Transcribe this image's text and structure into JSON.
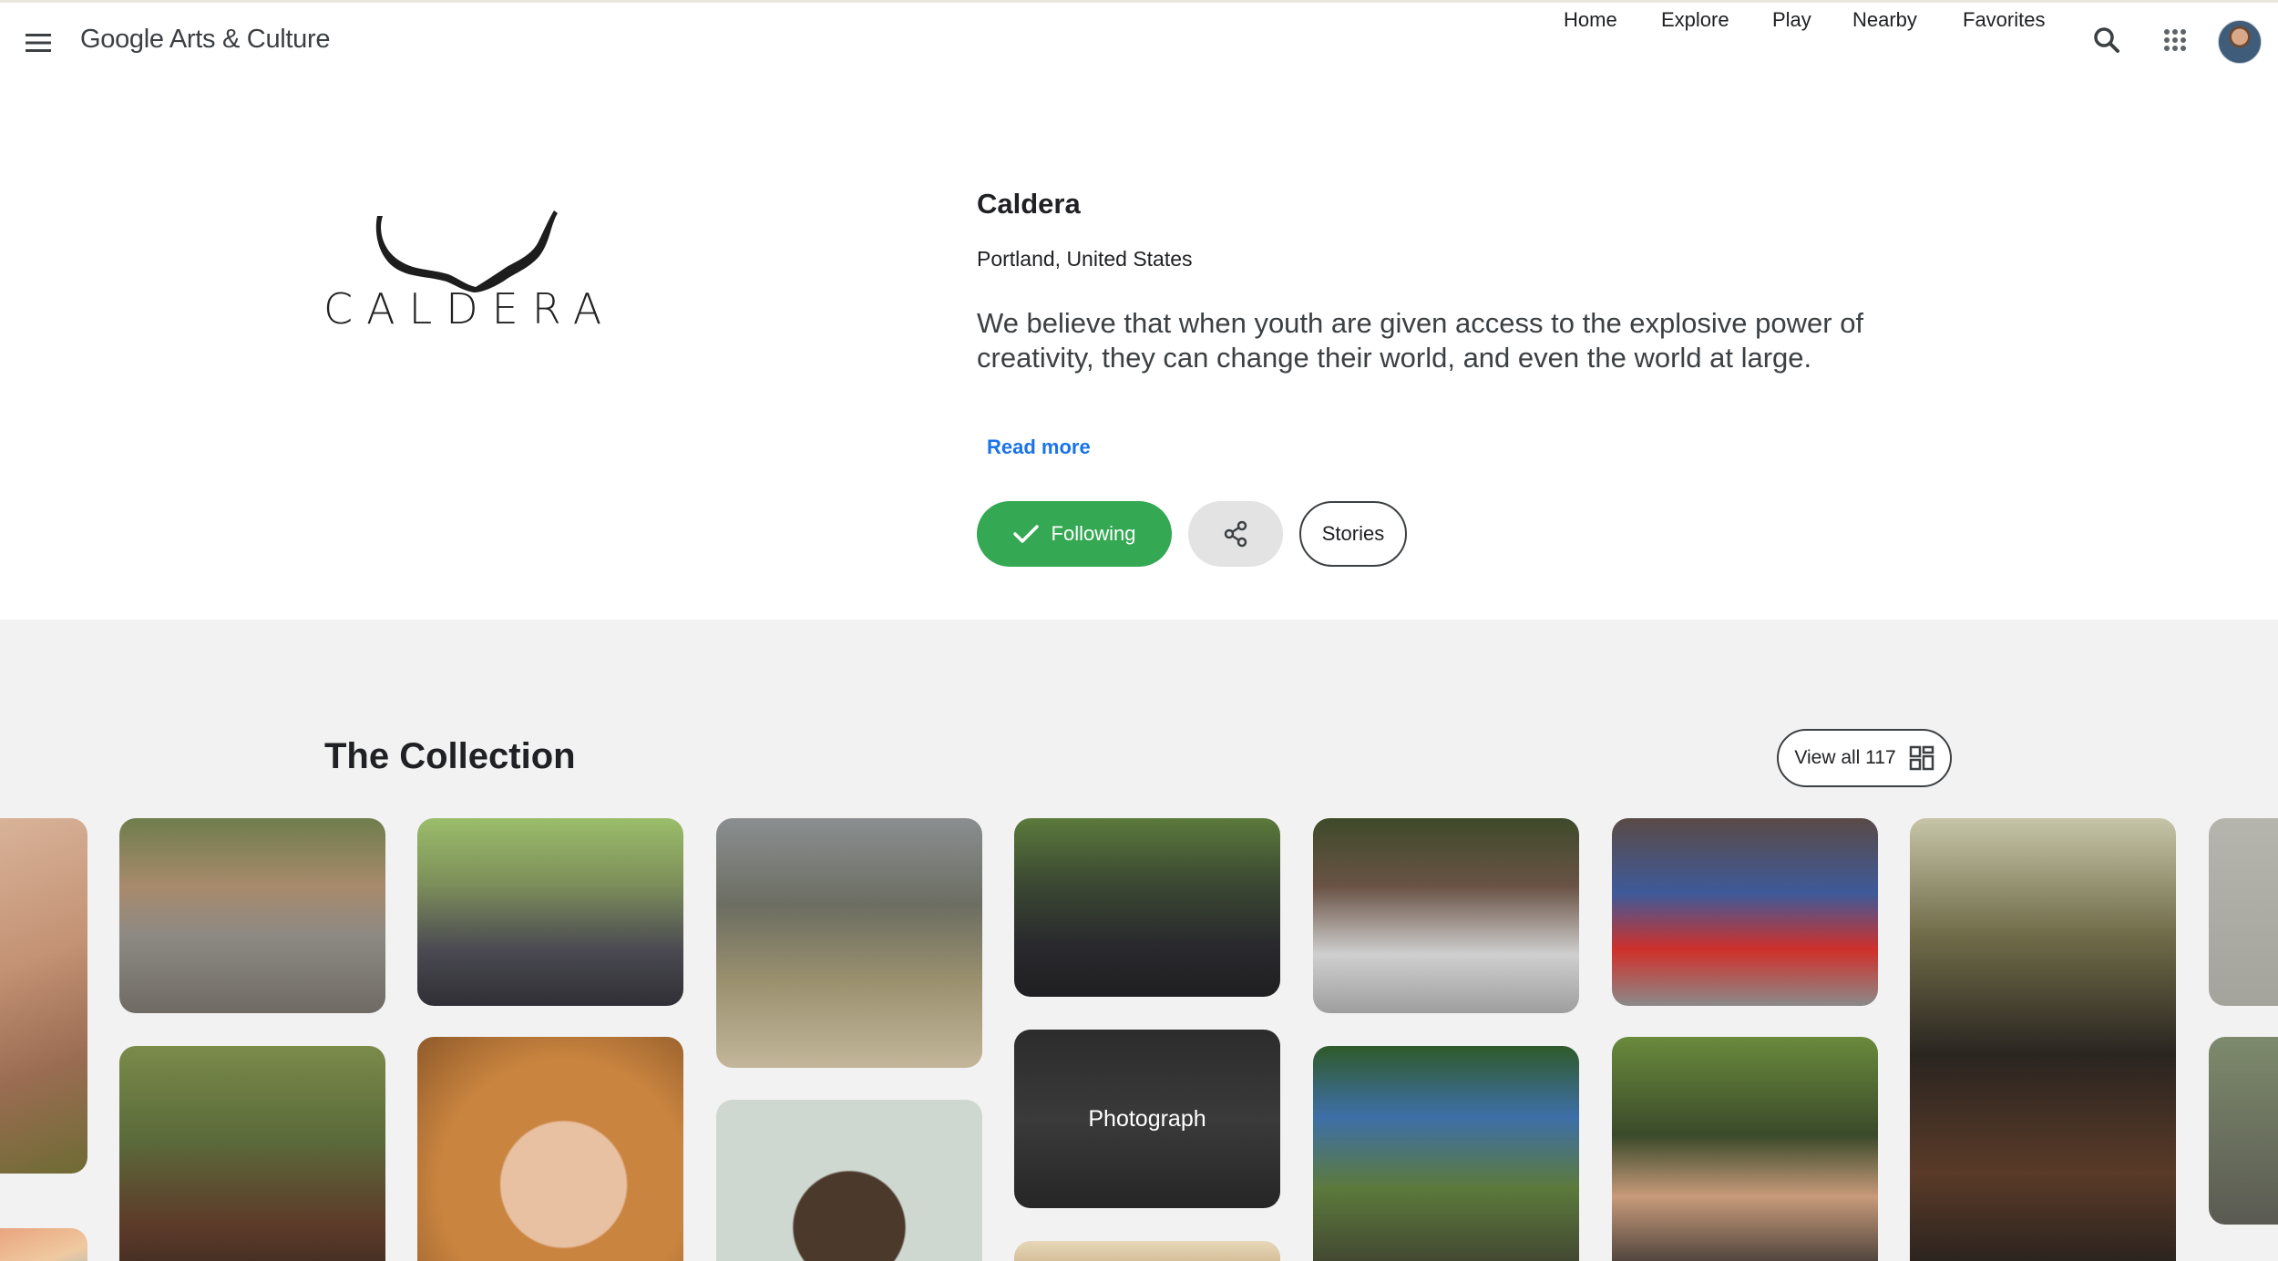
{
  "header": {
    "logo_google": "Google",
    "logo_rest": "Arts & Culture",
    "nav": [
      "Home",
      "Explore",
      "Play",
      "Nearby",
      "Favorites"
    ]
  },
  "partner": {
    "logo_text": "CALDERA",
    "name": "Caldera",
    "location": "Portland, United States",
    "description": "We believe that when youth are given access to the explosive power of creativity, they can change their world, and even the world at large.",
    "read_more": "Read more",
    "following_label": "Following",
    "stories_label": "Stories"
  },
  "collection": {
    "title": "The Collection",
    "view_all": "View all 117",
    "text_tile": "Photograph"
  },
  "colors": {
    "following_green": "#34a853",
    "link_blue": "#1a73e8",
    "collection_bg": "#f3f2f2"
  }
}
